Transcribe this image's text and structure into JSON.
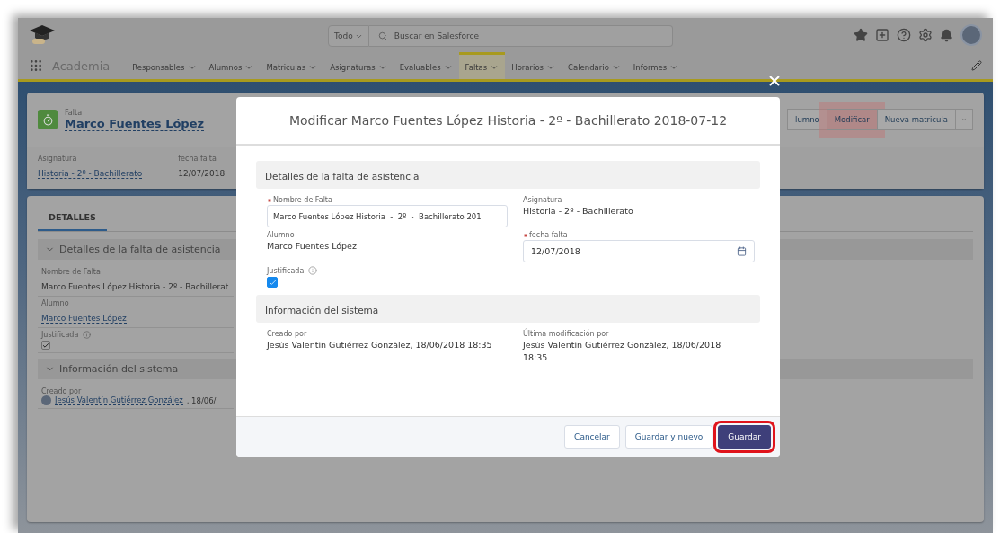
{
  "header": {
    "search_scope": "Todo",
    "search_placeholder": "Buscar en Salesforce"
  },
  "nav": {
    "app_name": "Academia",
    "tabs": [
      {
        "label": "Responsables",
        "selected": false
      },
      {
        "label": "Alumnos",
        "selected": false
      },
      {
        "label": "Matriculas",
        "selected": false
      },
      {
        "label": "Asignaturas",
        "selected": false
      },
      {
        "label": "Evaluables",
        "selected": false
      },
      {
        "label": "Faltas",
        "selected": true
      },
      {
        "label": "Horarios",
        "selected": false
      },
      {
        "label": "Calendario",
        "selected": false
      },
      {
        "label": "Informes",
        "selected": false
      }
    ]
  },
  "record": {
    "object_label": "Falta",
    "title": "Marco Fuentes López",
    "actions": [
      {
        "label": "lumno",
        "highlighted": false
      },
      {
        "label": "Modificar",
        "highlighted": true
      },
      {
        "label": "Nueva matricula",
        "highlighted": false
      }
    ],
    "fields": [
      {
        "kind": "link",
        "label": "Asignatura",
        "value": "Historia - 2º - Bachillerato"
      },
      {
        "kind": "text",
        "label": "fecha falta",
        "value": "12/07/2018"
      }
    ]
  },
  "details": {
    "tab": "DETALLES",
    "sections": [
      {
        "title": "Detalles de la falta de asistencia",
        "fields": [
          {
            "kind": "text",
            "label": "Nombre de Falta",
            "value": "Marco Fuentes López Historia - 2º - Bachillerat"
          },
          {
            "kind": "link",
            "label": "Alumno",
            "value": "Marco Fuentes López"
          },
          {
            "kind": "checkbox",
            "label": "Justificada",
            "checked": true
          }
        ]
      },
      {
        "title": "Información del sistema",
        "fields": [
          {
            "kind": "user",
            "label": "Creado por",
            "value": "Jesús Valentín Gutiérrez González",
            "suffix": ", 18/06/"
          }
        ]
      }
    ]
  },
  "modal": {
    "title": "Modificar Marco Fuentes López Historia - 2º - Bachillerato 2018-07-12",
    "sections": [
      {
        "title": "Detalles de la falta de asistencia",
        "fields": [
          {
            "kind": "input",
            "label": "Nombre de Falta",
            "required": true,
            "value": "Marco Fuentes López Historia  -  2º  -  Bachillerato 201"
          },
          {
            "kind": "text",
            "label": "Asignatura",
            "value": "Historia - 2º - Bachillerato"
          },
          {
            "kind": "text",
            "label": "Alumno",
            "value": "Marco Fuentes López"
          },
          {
            "kind": "date",
            "label": "fecha falta",
            "required": true,
            "value": "12/07/2018"
          },
          {
            "kind": "checkbox",
            "label": "Justificada",
            "checked": true
          }
        ]
      },
      {
        "title": "Información del sistema",
        "fields": [
          {
            "kind": "text",
            "label": "Creado por",
            "value": "Jesús Valentín Gutiérrez González, 18/06/2018 18:35"
          },
          {
            "kind": "text",
            "label": "Última modificación por",
            "value": "Jesús Valentín Gutiérrez González, 18/06/2018 18:35"
          }
        ]
      }
    ],
    "buttons": [
      {
        "kind": "neutral",
        "label": "Cancelar",
        "highlighted": false
      },
      {
        "kind": "neutral",
        "label": "Guardar y nuevo",
        "highlighted": false
      },
      {
        "kind": "brand",
        "label": "Guardar",
        "highlighted": true
      }
    ]
  }
}
